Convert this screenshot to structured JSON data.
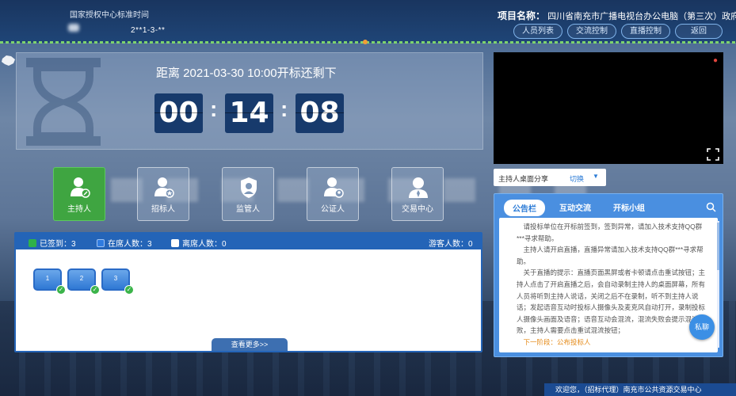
{
  "header": {
    "std_time_label": "国家授权中心标准时间",
    "std_time_value": "2**1-3-**",
    "project_label": "项目名称：",
    "project_name": "四川省南充市广播电视台办公电脑（第三次）政府采购",
    "nav": [
      {
        "label": "人员列表",
        "icon": "list-icon"
      },
      {
        "label": "交流控制",
        "icon": "chat-icon"
      },
      {
        "label": "直播控制",
        "icon": "video-icon"
      },
      {
        "label": "返回",
        "icon": "back-icon"
      }
    ]
  },
  "countdown": {
    "text": "距离 2021-03-30 10:00开标还剩下",
    "hours": "00",
    "minutes": "14",
    "seconds": "08",
    "separator": ":"
  },
  "roles": [
    {
      "label": "主持人",
      "icon": "host-icon",
      "active": true
    },
    {
      "label": "招标人",
      "icon": "tenderer-icon",
      "active": false
    },
    {
      "label": "监管人",
      "icon": "supervisor-icon",
      "active": false
    },
    {
      "label": "公证人",
      "icon": "notary-icon",
      "active": false
    },
    {
      "label": "交易中心",
      "icon": "trading-center-icon",
      "active": false
    }
  ],
  "attendance": {
    "signed_label": "已签到：3",
    "present_label": "在席人数：3",
    "absent_label": "离席人数：0",
    "guest_label": "游客人数：0",
    "seats": [
      "1",
      "2",
      "3"
    ],
    "more_label": "查看更多>>",
    "colors": {
      "signed": "#2fb24a",
      "present": "#2e7be0",
      "absent": "#ffffff"
    }
  },
  "share": {
    "label": "主持人桌面分享",
    "switch_label": "切换"
  },
  "notice": {
    "tabs": [
      "公告栏",
      "互动交流",
      "开标小组"
    ],
    "paragraphs": [
      "请投标单位在开标前签到，签到异常，请加入技术支持QQ群***寻求帮助。",
      "主持人请开启直播，直播异常请加入技术支持QQ群***寻求帮助。",
      "关于直播的提示：直播页面黑屏或者卡顿请点击重试按钮；主持人点击了开启直播之后，会自动录制主持人的桌面屏幕，所有人员将听到主持人说话，关闭之后不在录制，听不到主持人说话；发起语音互动时投标人摄像头及麦克风自动打开，录制投标人摄像头画面及语音；语音互动会混流，混流失败会提示混流失败，主持人需要点击重试混流按钮；"
    ],
    "next_stage": "下一阶段：公布投标人",
    "chat_label": "私聊"
  },
  "footer": {
    "welcome": "欢迎您，（招标代理）南充市公共资源交易中心"
  }
}
